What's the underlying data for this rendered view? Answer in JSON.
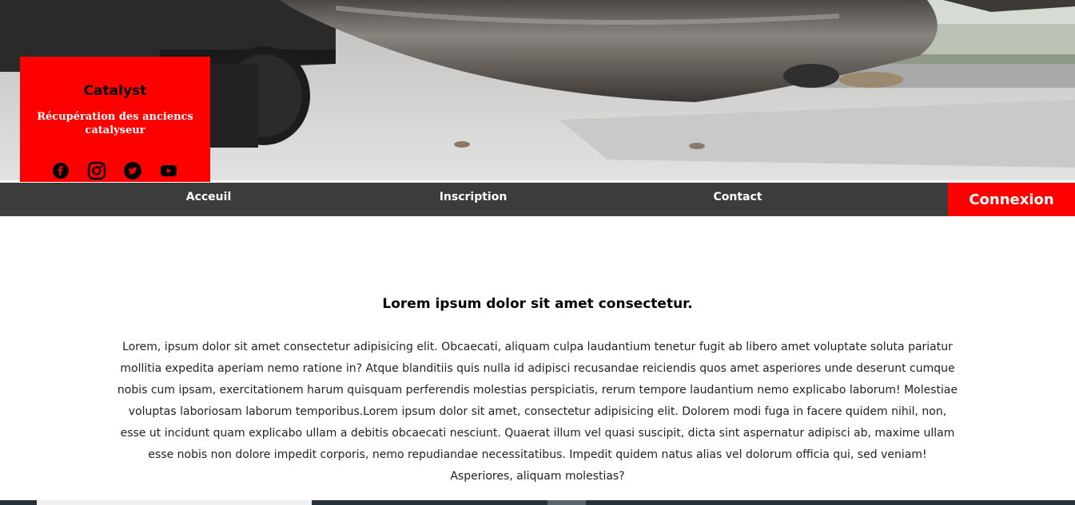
{
  "brand": {
    "title": "Catalyst",
    "subtitle": "Récupération des anciencs catalyseur",
    "socials": [
      "facebook-icon",
      "instagram-icon",
      "twitter-icon",
      "youtube-icon"
    ],
    "color": "#ff0000"
  },
  "nav": {
    "items": [
      {
        "label": "Acceuil"
      },
      {
        "label": "Inscription"
      },
      {
        "label": "Contact"
      }
    ],
    "login_label": "Connexion",
    "background": "#3c3c3c"
  },
  "main": {
    "title": "Lorem ipsum dolor sit amet consectetur.",
    "body": "Lorem, ipsum dolor sit amet consectetur adipisicing elit. Obcaecati, aliquam culpa laudantium tenetur fugit ab libero amet voluptate soluta pariatur mollitia expedita aperiam nemo ratione in? Atque blanditiis quis nulla id adipisci recusandae reiciendis quos amet asperiores unde deserunt cumque nobis cum ipsam, exercitationem harum quisquam perferendis molestias perspiciatis, rerum tempore laudantium nemo explicabo laborum! Molestiae voluptas laboriosam laborum temporibus.Lorem ipsum dolor sit amet, consectetur adipisicing elit. Dolorem modi fuga in facere quidem nihil, non, esse ut incidunt quam explicabo ullam a debitis obcaecati nesciunt. Quaerat illum vel quasi suscipit, dicta sint aspernatur adipisci ab, maxime ullam esse nobis non dolore impedit corporis, nemo repudiandae necessitatibus. Impedit quidem natus alias vel dolorum officia qui, sed veniam! Asperiores, aliquam molestias?"
  }
}
